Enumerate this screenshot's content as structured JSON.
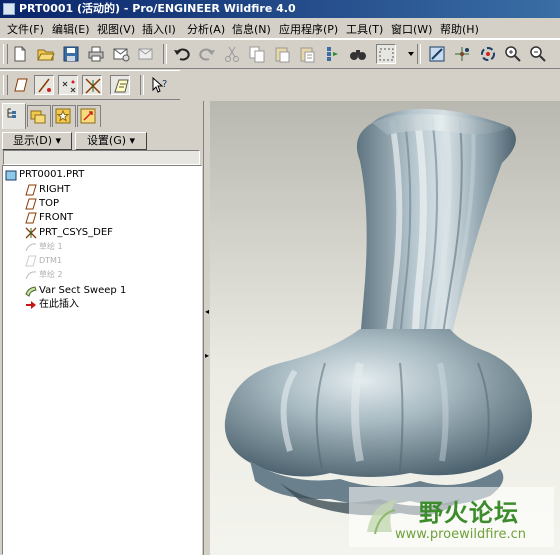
{
  "window": {
    "title": "PRT0001 (活动的) - Pro/ENGINEER Wildfire 4.0"
  },
  "menu": [
    "文件(F)",
    "编辑(E)",
    "视图(V)",
    "插入(I)",
    "分析(A)",
    "信息(N)",
    "应用程序(P)",
    "工具(T)",
    "窗口(W)",
    "帮助(H)"
  ],
  "panel": {
    "show_button": "显示(D) ▾",
    "settings_button": "设置(G) ▾",
    "tree": [
      {
        "label": "PRT0001.PRT",
        "icon": "part-icon",
        "dim": false
      },
      {
        "label": "RIGHT",
        "icon": "datum-plane-icon",
        "dim": false
      },
      {
        "label": "TOP",
        "icon": "datum-plane-icon",
        "dim": false
      },
      {
        "label": "FRONT",
        "icon": "datum-plane-icon",
        "dim": false
      },
      {
        "label": "PRT_CSYS_DEF",
        "icon": "csys-icon",
        "dim": false
      },
      {
        "label": "草绘 1",
        "icon": "sketch-icon",
        "dim": true
      },
      {
        "label": "DTM1",
        "icon": "datum-plane-icon",
        "dim": true
      },
      {
        "label": "草绘 2",
        "icon": "sketch-icon",
        "dim": true
      },
      {
        "label": "Var Sect Sweep 1",
        "icon": "sweep-icon",
        "dim": false
      },
      {
        "label": "在此插入",
        "icon": "insert-here-arrow-icon",
        "dim": false
      }
    ]
  },
  "watermark": {
    "title": "野火论坛",
    "url": "www.proewildfire.cn"
  },
  "colors": {
    "title_bar": "#0a246a",
    "model": "#9fb3bd",
    "viewport_top": "#b8b8b0"
  }
}
